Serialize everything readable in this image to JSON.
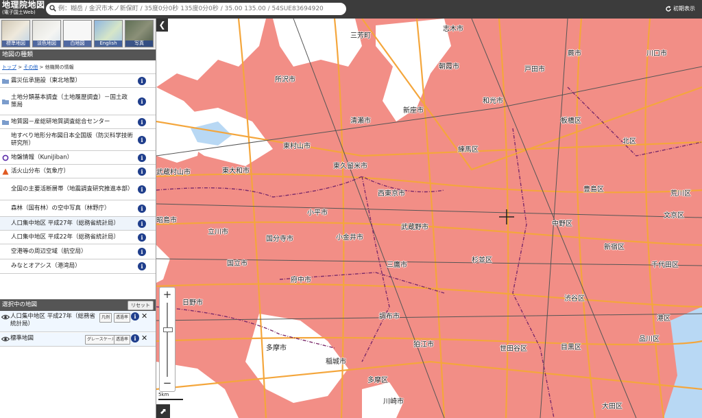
{
  "header": {
    "title_line1": "地理院地図",
    "title_line2": "(電子国土Web)",
    "search_placeholder": "例：糊岳 / 金沢市木ノ新保町 / 35度0分0秒 135度0分0秒 / 35.00 135.00 / 54SUE83694920",
    "reset_view_label": "初期表示"
  },
  "thumbnails": [
    {
      "label": "標準地図",
      "color": "#d9d4c8"
    },
    {
      "label": "淡色地図",
      "color": "#ecebe6"
    },
    {
      "label": "白地図",
      "color": "#f6f6f6"
    },
    {
      "label": "English",
      "color": "#a8c6e8"
    },
    {
      "label": "写真",
      "color": "#6f7c63"
    }
  ],
  "panel": {
    "maptype_title": "地図の種類",
    "breadcrumb": {
      "top": "トップ",
      "other": "その他",
      "current": "他機関の情報"
    },
    "layers": [
      {
        "label": "震災伝承施設（東北地整）",
        "icon": "folder-icon"
      },
      {
        "label": "土地分類基本調査（土地履歴調査）－国土政策局",
        "icon": "folder-icon"
      },
      {
        "label": "地質図－産総研地質調査総合センター",
        "icon": "folder-icon"
      },
      {
        "label": "地すべり地形分布図日本全国版（防災科学技術研究所）",
        "icon": "none"
      },
      {
        "label": "地盤情報（KuniJiban）",
        "icon": "circle-icon"
      },
      {
        "label": "活火山分布（気象庁）",
        "icon": "triangle-icon"
      },
      {
        "label": "全国の主要活断層帯（地震調査研究推進本部）",
        "icon": "none"
      },
      {
        "label": "森林（国有林）の空中写真（林野庁）",
        "icon": "none"
      },
      {
        "label": "人口集中地区 平成27年（総務省統計局）",
        "icon": "none"
      },
      {
        "label": "人口集中地区 平成22年（総務省統計局）",
        "icon": "none"
      },
      {
        "label": "空港等の周辺空域（航空局）",
        "icon": "none"
      },
      {
        "label": "みなとオアシス（港湾局）",
        "icon": "none"
      }
    ],
    "info_glyph": "i",
    "selected_title": "選択中の地図",
    "reset_label": "リセット",
    "selected": [
      {
        "name": "人口集中地区 平成27年（総務省統計局）",
        "btn1": "凡例",
        "btn2": "透過率"
      },
      {
        "name": "標準地図",
        "btn1": "グレースケール",
        "btn2": "透過率"
      }
    ],
    "close_glyph": "✕"
  },
  "map": {
    "collapse_glyph": "❮",
    "zoom_in": "+",
    "zoom_out": "−",
    "scale_label": "5km",
    "expand_glyph": "⬈",
    "colors": {
      "did_fill": "#f28e86",
      "base": "#ffffff",
      "road": "#f4a63c",
      "rail": "#555555",
      "water": "#b8d8f4",
      "boundary": "#7a2a6a"
    },
    "labels": [
      "三芳町",
      "志木市",
      "朝霞市",
      "和光市",
      "戸田市",
      "川口市",
      "蕨市",
      "板橋区",
      "北区",
      "荒川区",
      "所沢市",
      "清瀬市",
      "新座市",
      "東村山市",
      "東久留米市",
      "練馬区",
      "豊島区",
      "文京区",
      "武蔵村山市",
      "東大和市",
      "西東京市",
      "小平市",
      "武蔵野市",
      "中野区",
      "新宿区",
      "昭島市",
      "立川市",
      "国分寺市",
      "小金井市",
      "杉並区",
      "千代田区",
      "国立市",
      "府中市",
      "三鷹市",
      "渋谷区",
      "港区",
      "日野市",
      "調布市",
      "狛江市",
      "世田谷区",
      "目黒区",
      "品川区",
      "多摩市",
      "稲城市",
      "多摩区",
      "川崎市",
      "大田区"
    ]
  }
}
